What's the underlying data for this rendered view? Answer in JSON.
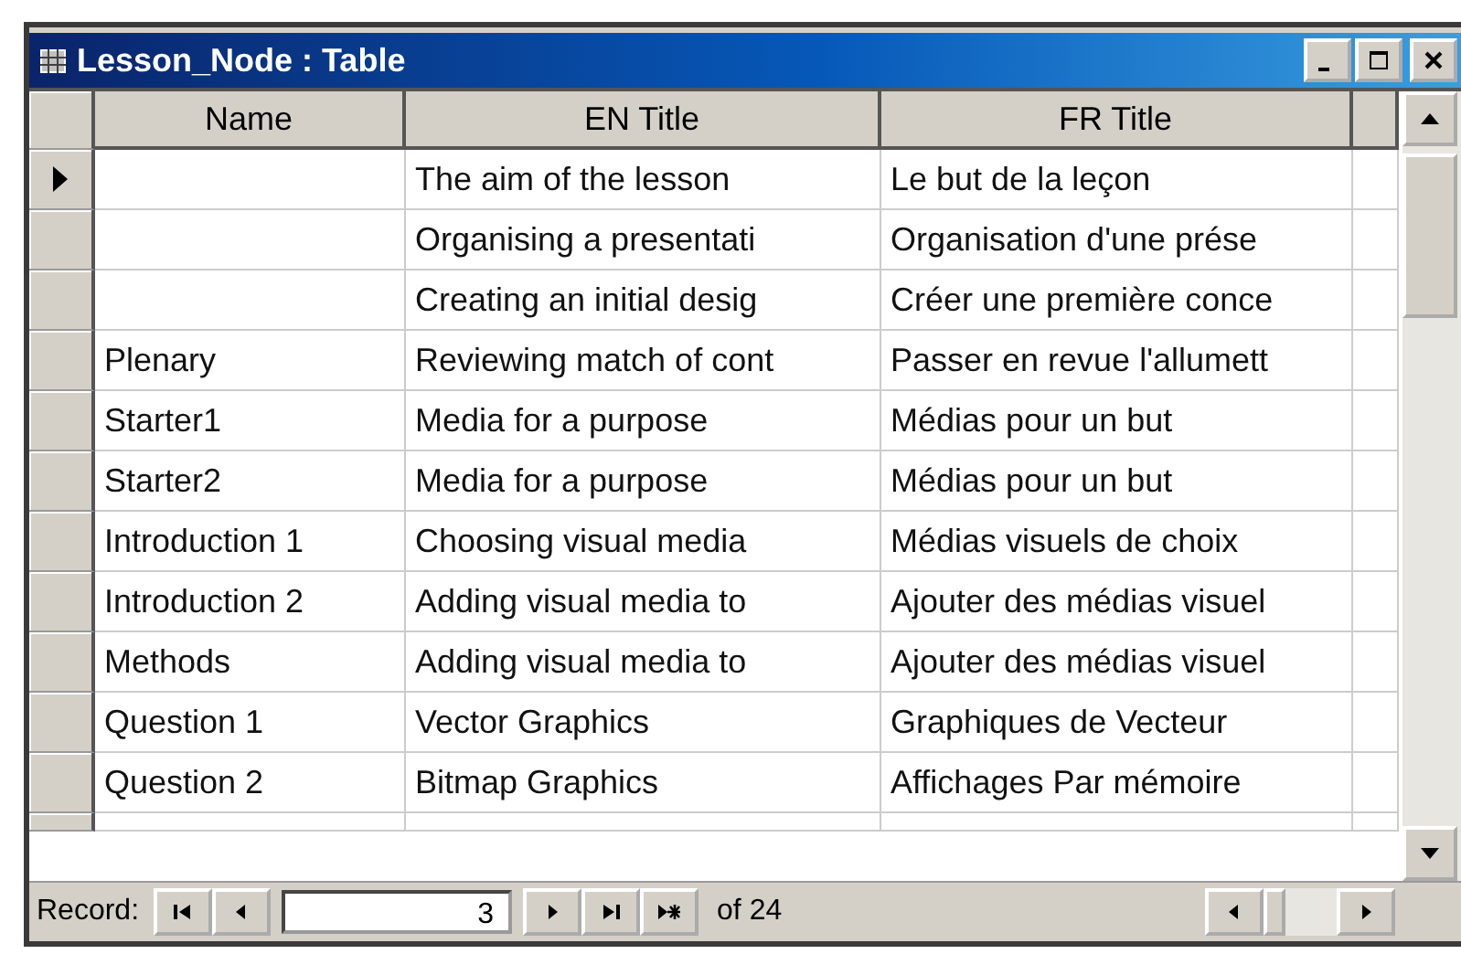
{
  "window": {
    "title": "Lesson_Node : Table"
  },
  "table": {
    "columns": [
      "Name",
      "EN Title",
      "FR Title"
    ],
    "rows": [
      {
        "current": true,
        "cells": [
          "",
          "The aim of the lesson",
          "Le but de la leçon"
        ]
      },
      {
        "current": false,
        "cells": [
          "",
          "Organising a presentati",
          "Organisation d'une prése"
        ]
      },
      {
        "current": false,
        "cells": [
          "",
          "Creating an initial desig",
          "Créer une première conce"
        ]
      },
      {
        "current": false,
        "cells": [
          "Plenary",
          "Reviewing match of cont",
          "Passer en revue l'allumett"
        ]
      },
      {
        "current": false,
        "cells": [
          "Starter1",
          "Media for a purpose",
          "Médias pour un but"
        ]
      },
      {
        "current": false,
        "cells": [
          "Starter2",
          "Media for a purpose",
          "Médias pour un but"
        ]
      },
      {
        "current": false,
        "cells": [
          "Introduction 1",
          "Choosing visual media",
          "Médias visuels de choix"
        ]
      },
      {
        "current": false,
        "cells": [
          "Introduction 2",
          "Adding visual media to",
          "Ajouter des médias visuel"
        ]
      },
      {
        "current": false,
        "cells": [
          "Methods",
          "Adding visual media to",
          "Ajouter des médias visuel"
        ]
      },
      {
        "current": false,
        "cells": [
          "Question 1",
          "Vector Graphics",
          "Graphiques de Vecteur"
        ]
      },
      {
        "current": false,
        "cells": [
          "Question 2",
          "Bitmap Graphics",
          "Affichages Par mémoire"
        ]
      }
    ]
  },
  "navigation": {
    "label": "Record:",
    "record": "3",
    "total": "of 24"
  }
}
